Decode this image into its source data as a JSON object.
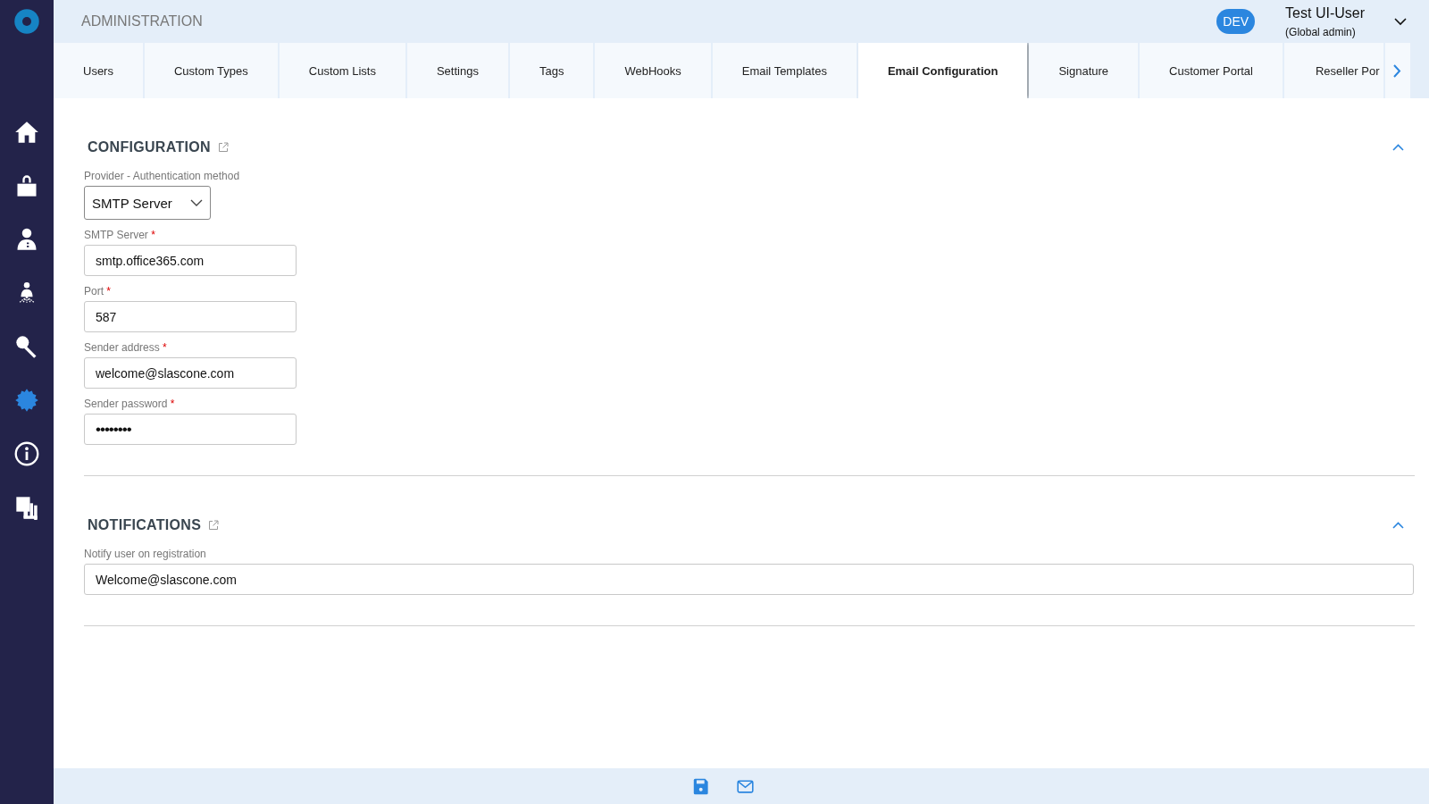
{
  "sidebar": {
    "items": [
      {
        "kind": "home",
        "selected": false
      },
      {
        "kind": "bag",
        "selected": false
      },
      {
        "kind": "person",
        "selected": false
      },
      {
        "kind": "hierarchy",
        "selected": false
      },
      {
        "kind": "key",
        "selected": false
      },
      {
        "kind": "gear",
        "selected": true
      },
      {
        "kind": "info",
        "selected": false
      },
      {
        "kind": "help",
        "selected": false
      }
    ]
  },
  "header": {
    "title": "ADMINISTRATION",
    "environment_badge": "DEV",
    "user_name": "Test UI-User",
    "user_role": "(Global admin)"
  },
  "tabs": [
    {
      "label": "Users",
      "selected": false
    },
    {
      "label": "Custom Types",
      "selected": false
    },
    {
      "label": "Custom Lists",
      "selected": false
    },
    {
      "label": "Settings",
      "selected": false
    },
    {
      "label": "Tags",
      "selected": false
    },
    {
      "label": "WebHooks",
      "selected": false
    },
    {
      "label": "Email Templates",
      "selected": false
    },
    {
      "label": "Email Configuration",
      "selected": true
    },
    {
      "label": "Signature",
      "selected": false
    },
    {
      "label": "Customer Portal",
      "selected": false
    },
    {
      "label": "Reseller Por",
      "selected": false
    }
  ],
  "sections": [
    {
      "title": "CONFIGURATION",
      "expanded": true,
      "fields": [
        {
          "kind": "select",
          "label": "Provider - Authentication method",
          "value": "SMTP Server"
        },
        {
          "kind": "text",
          "label": "SMTP Server",
          "required_mark": "*",
          "value": "smtp.office365.com"
        },
        {
          "kind": "text",
          "label": "Port",
          "required_mark": "*",
          "value": "587"
        },
        {
          "kind": "text",
          "label": "Sender address",
          "required_mark": "*",
          "value": "welcome@slascone.com"
        },
        {
          "kind": "password",
          "label": "Sender password",
          "required_mark": "*",
          "value": "••••••••"
        }
      ]
    },
    {
      "title": "NOTIFICATIONS",
      "expanded": true,
      "fields": [
        {
          "kind": "wide",
          "label": "Notify user on registration",
          "value": "Welcome@slascone.com"
        }
      ]
    }
  ],
  "footer": {
    "actions": [
      {
        "kind": "save"
      },
      {
        "kind": "email"
      }
    ]
  }
}
